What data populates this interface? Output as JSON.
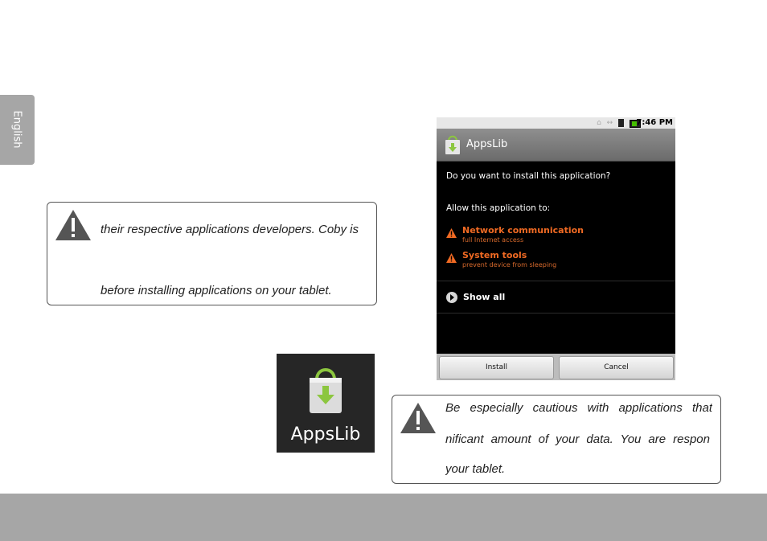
{
  "side_tab": {
    "label": "English"
  },
  "notice_top": {
    "line1": "their respective applications developers. Coby is",
    "line2": "before installing applications on your tablet."
  },
  "app_icon": {
    "label": "AppsLib",
    "icon": "shopping-bag-download-icon",
    "accent": "#8cc63f"
  },
  "phone_screen": {
    "status_bar": {
      "time": "7:46 PM",
      "icons": [
        "home-icon",
        "sync-icon",
        "wifi-icon",
        "battery-icon",
        "signal-icon"
      ]
    },
    "title": "AppsLib",
    "question": "Do you want to install this application?",
    "allow_label": "Allow this application to:",
    "permissions": [
      {
        "title": "Network communication",
        "subtitle": "full Internet access"
      },
      {
        "title": "System tools",
        "subtitle": "prevent device from sleeping"
      }
    ],
    "show_all": "Show all",
    "buttons": {
      "install": "Install",
      "cancel": "Cancel"
    },
    "warning_color": "#f06a23"
  },
  "notice_bottom": {
    "line1": "Be especially cautious with applications that",
    "line2": "nificant amount of your data. You are respon",
    "line3": "your tablet."
  }
}
